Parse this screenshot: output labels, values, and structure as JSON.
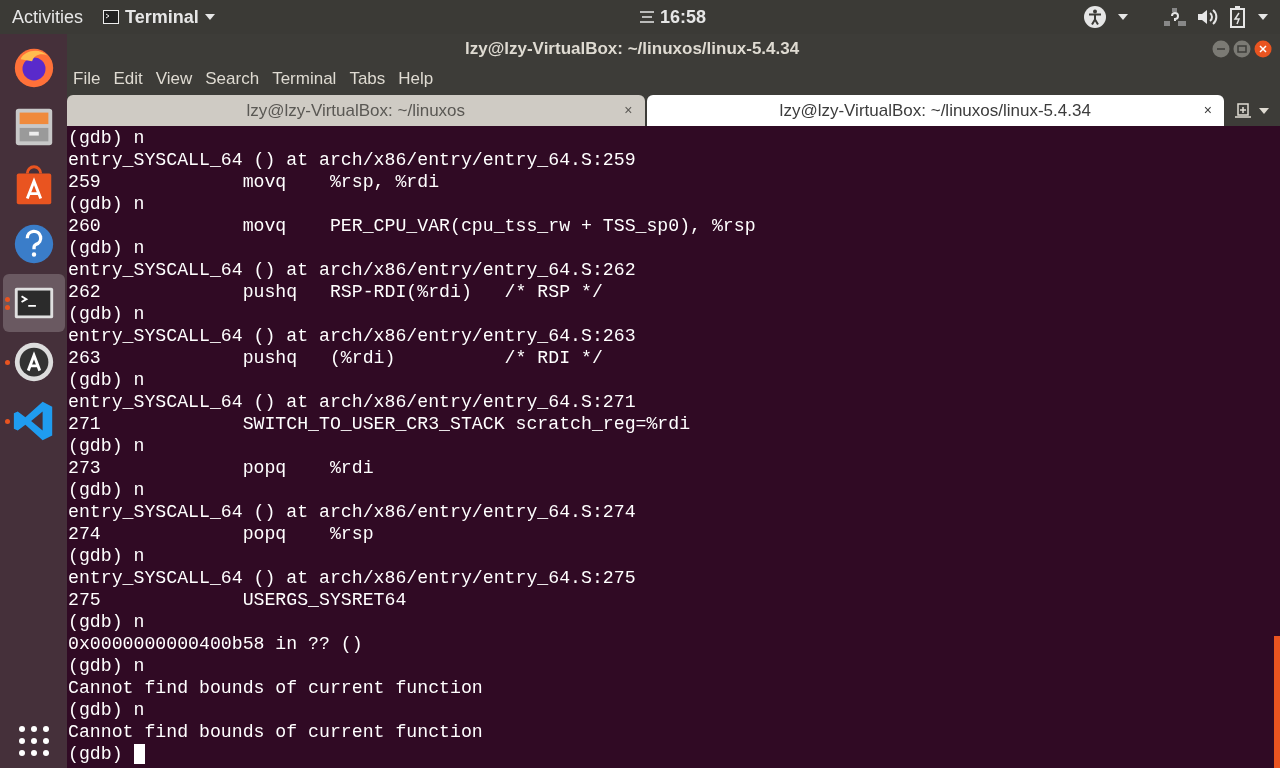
{
  "top_bar": {
    "activities": "Activities",
    "app_menu": "Terminal",
    "clock": "16:58"
  },
  "dock": [
    {
      "kind": "firefox",
      "running": false,
      "selected": false,
      "multiple_windows": false
    },
    {
      "kind": "files",
      "running": false,
      "selected": false,
      "multiple_windows": false
    },
    {
      "kind": "software",
      "running": false,
      "selected": false,
      "multiple_windows": false
    },
    {
      "kind": "help",
      "running": false,
      "selected": false,
      "multiple_windows": false
    },
    {
      "kind": "terminal",
      "running": true,
      "selected": true,
      "multiple_windows": true
    },
    {
      "kind": "updater",
      "running": true,
      "selected": false,
      "multiple_windows": false
    },
    {
      "kind": "vscode",
      "running": true,
      "selected": false,
      "multiple_windows": false
    }
  ],
  "window": {
    "title": "lzy@lzy-VirtualBox: ~/linuxos/linux-5.4.34"
  },
  "menu": [
    "File",
    "Edit",
    "View",
    "Search",
    "Terminal",
    "Tabs",
    "Help"
  ],
  "tabs": [
    {
      "label": "lzy@lzy-VirtualBox: ~/linuxos",
      "close": "×",
      "selected": false
    },
    {
      "label": "lzy@lzy-VirtualBox: ~/linuxos/linux-5.4.34",
      "close": "×",
      "selected": true
    }
  ],
  "terminal_lines": [
    "(gdb) n",
    "entry_SYSCALL_64 () at arch/x86/entry/entry_64.S:259",
    "259             movq    %rsp, %rdi",
    "(gdb) n",
    "260             movq    PER_CPU_VAR(cpu_tss_rw + TSS_sp0), %rsp",
    "(gdb) n",
    "entry_SYSCALL_64 () at arch/x86/entry/entry_64.S:262",
    "262             pushq   RSP-RDI(%rdi)   /* RSP */",
    "(gdb) n",
    "entry_SYSCALL_64 () at arch/x86/entry/entry_64.S:263",
    "263             pushq   (%rdi)          /* RDI */",
    "(gdb) n",
    "entry_SYSCALL_64 () at arch/x86/entry/entry_64.S:271",
    "271             SWITCH_TO_USER_CR3_STACK scratch_reg=%rdi",
    "(gdb) n",
    "273             popq    %rdi",
    "(gdb) n",
    "entry_SYSCALL_64 () at arch/x86/entry/entry_64.S:274",
    "274             popq    %rsp",
    "(gdb) n",
    "entry_SYSCALL_64 () at arch/x86/entry/entry_64.S:275",
    "275             USERGS_SYSRET64",
    "(gdb) n",
    "0x0000000000400b58 in ?? ()",
    "(gdb) n",
    "Cannot find bounds of current function",
    "(gdb) n",
    "Cannot find bounds of current function"
  ],
  "prompt": "(gdb) "
}
